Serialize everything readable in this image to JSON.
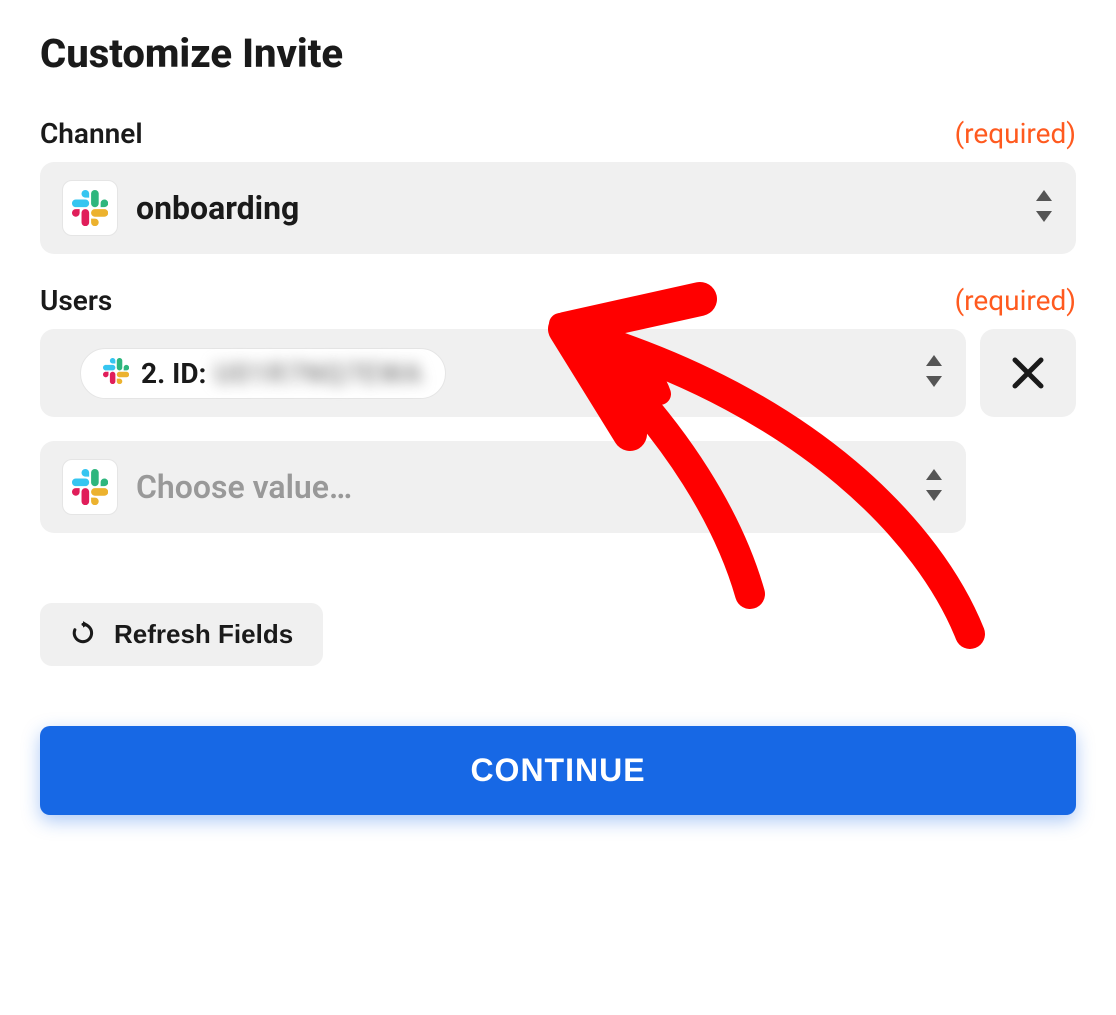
{
  "title": "Customize Invite",
  "fields": {
    "channel": {
      "label": "Channel",
      "required_text": "(required)",
      "value": "onboarding",
      "icon": "slack-icon"
    },
    "users": {
      "label": "Users",
      "required_text": "(required)",
      "selected": {
        "prefix": "2. ID:",
        "value_hidden": true,
        "icon": "slack-icon"
      },
      "add_placeholder": "Choose value…",
      "add_icon": "slack-icon"
    }
  },
  "buttons": {
    "refresh": "Refresh Fields",
    "continue": "CONTINUE",
    "remove": "×"
  },
  "annotation": {
    "type": "hand-drawn-arrow",
    "color": "#ff0000"
  }
}
